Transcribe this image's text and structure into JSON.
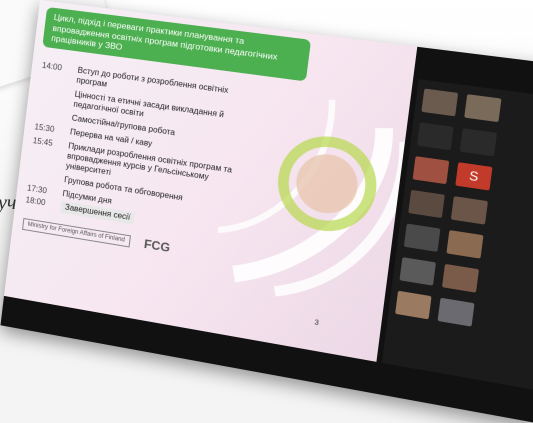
{
  "slide": {
    "title": "Цикл, підхід і переваги практики планування та впровадження освітніх програм підготовки педагогічних працівників у ЗВО",
    "agenda": [
      {
        "time": "14:00",
        "text": "Вступ до роботи з розроблення освітніх програм"
      },
      {
        "time": "",
        "text": "Цінності та етичні засади викладання й педагогічної освіти"
      },
      {
        "time": "",
        "text": "Самостійна/групова робота"
      },
      {
        "time": "15:30",
        "text": "Перерва на чай / каву"
      },
      {
        "time": "15:45",
        "text": "Приклади розроблення освітніх програм та впровадження курсів у Гельсінському університеті"
      },
      {
        "time": "",
        "text": "Групова робота та обговорення"
      },
      {
        "time": "17:30",
        "text": "Підсумки дня"
      }
    ],
    "end_time": "18:00",
    "end_text": "Завершення сесії",
    "logos": [
      "Ministry for Foreign Affairs of Finland",
      "FCG"
    ],
    "page_number": "3"
  },
  "side_text": "уч",
  "gallery": {
    "tiles": [
      {
        "color": "#6b5a4e"
      },
      {
        "color": "#7a6a5a"
      },
      {
        "color": "#2a2a2a"
      },
      {
        "color": "#2a2a2a"
      },
      {
        "color": "#a05040"
      },
      {
        "color": "#c23a2a"
      },
      {
        "color": "#5a4a40"
      },
      {
        "color": "#6a5548"
      },
      {
        "color": "#4a4a4a"
      },
      {
        "color": "#8a6a50"
      },
      {
        "color": "#5a5a5a"
      },
      {
        "color": "#7a5a48"
      },
      {
        "color": "#9a7a60"
      },
      {
        "color": "#6a6a70"
      }
    ],
    "self_label": "S"
  },
  "colors": {
    "title_bg": "#4caf50",
    "slide_bg": "#f7e6f0",
    "gallery_bg": "#1b1b1b"
  }
}
